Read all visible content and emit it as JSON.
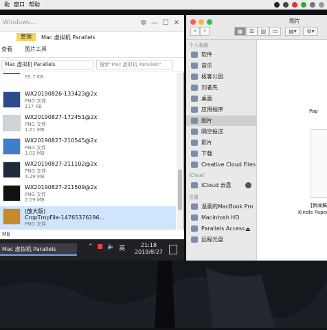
{
  "menubar": {
    "items": [
      "助",
      "窗口",
      "帮助"
    ],
    "app_name": "Windows",
    "finder_label": "图片"
  },
  "windows": {
    "title_placeholder": "Windows...",
    "manage_tab": "管理",
    "window_title": "Mac 虚拟机 Parallels",
    "ribbon_tabs": [
      "查看",
      "图片工具"
    ],
    "address": "Mac 虚拟机 Parallels",
    "search_placeholder": "搜索\"Mac 虚拟机 Parallels\"",
    "files": [
      {
        "name": "",
        "type": "",
        "size": "95.7 KB"
      },
      {
        "name": "WX20190826-133423@2x",
        "type": "PNG 文件",
        "size": "117 KB"
      },
      {
        "name": "WX20190827-172451@2x",
        "type": "PNG 文件",
        "size": "1.21 MB"
      },
      {
        "name": "WX20190827-210545@2x",
        "type": "PNG 文件",
        "size": "1.02 MB"
      },
      {
        "name": "WX20190827-211102@2x",
        "type": "PNG 文件",
        "size": "4.29 MB"
      },
      {
        "name": "WX20190827-211509@2x",
        "type": "PNG 文件",
        "size": "2.09 MB"
      },
      {
        "name": "CropTmpFile-14765376196...",
        "type": "PNG 文件",
        "size": "(放大版)"
      }
    ],
    "status_text": "MB",
    "taskbar_item": "Mac 虚拟机 Parallels",
    "tray_lang": "英",
    "clock_time": "21:18",
    "clock_date": "2019/8/27"
  },
  "finder": {
    "title": "图片",
    "sections": {
      "favorites": "个人收藏",
      "icloud": "iCloud",
      "locations": "位置"
    },
    "favorites": [
      "软件",
      "音乐",
      "极客公园",
      "刘者先",
      "桌面",
      "应用程序",
      "图片",
      "隔空投送",
      "影片",
      "下载",
      "Creative Cloud Files"
    ],
    "icloud_items": [
      "iCloud 云盘"
    ],
    "locations": [
      "温豪的MacBook Pro",
      "Macintosh HD",
      "Parallels Access",
      "远程光盘"
    ],
    "preview_label_1": "Pop",
    "preview_label_2": "【新闻稿】",
    "preview_label_3": "Kindle Paper"
  }
}
